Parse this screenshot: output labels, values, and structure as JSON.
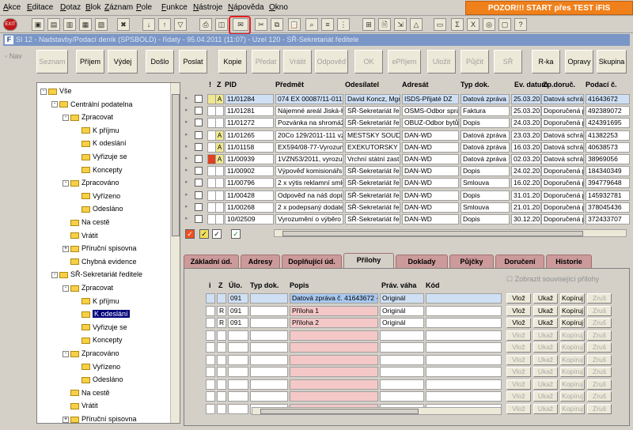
{
  "menu": [
    "Akce",
    "Editace",
    "Dotaz",
    "Blok",
    "Záznam",
    "Pole",
    "Funkce",
    "Nástroje",
    "Nápověda",
    "Okno"
  ],
  "banner": "POZOR!!! START přes TEST iFIS",
  "window_title": "SI 12 - Nadstavby/Podací deník (SPSBOLD) - řídaty - 95.04.2011 (11:07) - Uzel 120 - SŘ-Sekretariát ředitele",
  "nav_label": "Nav",
  "buttons": [
    {
      "label": "Seznam",
      "enabled": false
    },
    {
      "label": "Příjem",
      "enabled": true
    },
    {
      "label": "Výdej",
      "enabled": true
    },
    {
      "label": "Došlo",
      "enabled": true
    },
    {
      "label": "Poslat",
      "enabled": true
    },
    {
      "label": "Kopie",
      "enabled": true
    },
    {
      "label": "Předat",
      "enabled": false
    },
    {
      "label": "Vrátit",
      "enabled": false
    },
    {
      "label": "Odpověď",
      "enabled": false
    },
    {
      "label": "OK",
      "enabled": false
    },
    {
      "label": "ePříjem",
      "enabled": false
    },
    {
      "label": "Uložit",
      "enabled": false
    },
    {
      "label": "Půjčit",
      "enabled": false
    },
    {
      "label": "SŘ",
      "enabled": false
    },
    {
      "label": "R-ka",
      "enabled": true
    },
    {
      "label": "Opravy",
      "enabled": true
    },
    {
      "label": "Skupina",
      "enabled": true
    }
  ],
  "tree": [
    {
      "label": "Vše",
      "level": 0,
      "exp": "-"
    },
    {
      "label": "Centrální podatelna",
      "level": 1,
      "exp": "-"
    },
    {
      "label": "Zpracovat",
      "level": 2,
      "exp": "-"
    },
    {
      "label": "K příjmu",
      "level": 3,
      "exp": ""
    },
    {
      "label": "K odeslání",
      "level": 3,
      "exp": ""
    },
    {
      "label": "Vyřizuje se",
      "level": 3,
      "exp": ""
    },
    {
      "label": "Koncepty",
      "level": 3,
      "exp": ""
    },
    {
      "label": "Zpracováno",
      "level": 2,
      "exp": "-"
    },
    {
      "label": "Vyřízeno",
      "level": 3,
      "exp": ""
    },
    {
      "label": "Odesláno",
      "level": 3,
      "exp": ""
    },
    {
      "label": "Na cestě",
      "level": 2,
      "exp": ""
    },
    {
      "label": "Vrátit",
      "level": 2,
      "exp": ""
    },
    {
      "label": "Příruční spisovna",
      "level": 2,
      "exp": "+"
    },
    {
      "label": "Chybná evidence",
      "level": 2,
      "exp": ""
    },
    {
      "label": "SŘ-Sekretariát ředitele",
      "level": 1,
      "exp": "-"
    },
    {
      "label": "Zpracovat",
      "level": 2,
      "exp": "-"
    },
    {
      "label": "K příjmu",
      "level": 3,
      "exp": ""
    },
    {
      "label": "K odeslání",
      "level": 3,
      "exp": "",
      "selected": true
    },
    {
      "label": "Vyřizuje se",
      "level": 3,
      "exp": ""
    },
    {
      "label": "Koncepty",
      "level": 3,
      "exp": ""
    },
    {
      "label": "Zpracováno",
      "level": 2,
      "exp": "-"
    },
    {
      "label": "Vyřízeno",
      "level": 3,
      "exp": ""
    },
    {
      "label": "Odesláno",
      "level": 3,
      "exp": ""
    },
    {
      "label": "Na cestě",
      "level": 2,
      "exp": ""
    },
    {
      "label": "Vrátit",
      "level": 2,
      "exp": ""
    },
    {
      "label": "Příruční spisovna",
      "level": 2,
      "exp": "+"
    }
  ],
  "grid": {
    "headers": [
      "!",
      "Z",
      "PID",
      "Předmět",
      "Odesílatel",
      "Adresát",
      "Typ dok.",
      "Ev. datum",
      "Zp.doruč.",
      "Podací č."
    ],
    "rows": [
      [
        "",
        "A",
        "11/01284",
        "074 EX 00087/11-011, ",
        "David Koncz, Mgr.",
        "ISDS-Přijaté DZ",
        "Datová zpráva",
        "25.03.2011",
        "Datová schrá",
        "41643672"
      ],
      [
        "",
        "",
        "11/01281",
        "Nájemné areál Jiská-H",
        "SŘ-Sekretariát řed",
        "OSMS-Odbor sprá",
        "Faktura",
        "25.03.2011",
        "Doporučená p",
        "492389072"
      ],
      [
        "",
        "",
        "11/01272",
        "Pozvánka na shromáž",
        "SŘ-Sekretariát řed",
        "OBUZ-Odbor bytů",
        "Dopis",
        "24.03.2011",
        "Doporučená p",
        "424391695"
      ],
      [
        "",
        "A",
        "11/01265",
        "20Co 129/2011-111 vz",
        "MESTSKY SOUD V",
        "DAN-WD",
        "Datová zpráva",
        "23.03.2011",
        "Datová schrá",
        "41382253"
      ],
      [
        "",
        "A",
        "11/01158",
        "EX594/08-77-Vyrozum",
        "EXEKUTORSKY Ú",
        "DAN-WD",
        "Datová zpráva",
        "16.03.2011",
        "Datová schrá",
        "40638573"
      ],
      [
        "red",
        "A",
        "11/00939",
        "1VZN53/2011, vyrozu",
        "Vrchní státní zast.",
        "DAN-WD",
        "Datová zpráva",
        "02.03.2011",
        "Datová schrá",
        "38969056"
      ],
      [
        "",
        "",
        "11/00902",
        "Výpověď komisionářs",
        "SŘ-Sekretariát řed",
        "DAN-WD",
        "Dopis",
        "24.02.2011",
        "Doporučená p",
        "184340349"
      ],
      [
        "",
        "",
        "11/00796",
        "2 x výtis reklamní smlo",
        "SŘ-Sekretariát řed",
        "DAN-WD",
        "Smlouva",
        "16.02.2011",
        "Doporučená p",
        "394779648"
      ],
      [
        "",
        "",
        "11/00428",
        "Odpověď na náš dopis",
        "SŘ-Sekretariát řed",
        "DAN-WD",
        "Dopis",
        "31.01.2011",
        "Doporučená p",
        "145932781"
      ],
      [
        "",
        "",
        "11/00268",
        "2 x podepsaný dodate",
        "SŘ-Sekretariát řed",
        "DAN-WD",
        "Smlouva",
        "21.01.2011",
        "Doporučená p",
        "378045436"
      ],
      [
        "",
        "",
        "10/02509",
        "Vyrozumění o výběro",
        "SŘ-Sekretariát řed",
        "DAN-WD",
        "Dopis",
        "30.12.2010",
        "Doporučená p",
        "372433707"
      ]
    ]
  },
  "tabs": [
    "Základní úd.",
    "Adresy",
    "Doplňující úd.",
    "Přílohy",
    "Doklady",
    "Půjčky",
    "Doručení",
    "Historie"
  ],
  "active_tab": "Přílohy",
  "attachments": {
    "show_related_label": "Zobrazit související přílohy",
    "headers": [
      "i",
      "Z",
      "Úlo.",
      "Typ dok.",
      "Popis",
      "Práv. váha",
      "Kód"
    ],
    "rows": [
      [
        "",
        "",
        "091",
        "",
        "Datová zpráva č. 41643672 - ",
        "Originál",
        ""
      ],
      [
        "",
        "R",
        "091",
        "",
        "Příloha 1",
        "Originál",
        ""
      ],
      [
        "",
        "R",
        "091",
        "",
        "Příloha 2",
        "Originál",
        ""
      ]
    ],
    "empty_rows": 7,
    "buttons": [
      "Vlož",
      "Ukaž",
      "Kopíruj",
      "Zruš"
    ]
  }
}
